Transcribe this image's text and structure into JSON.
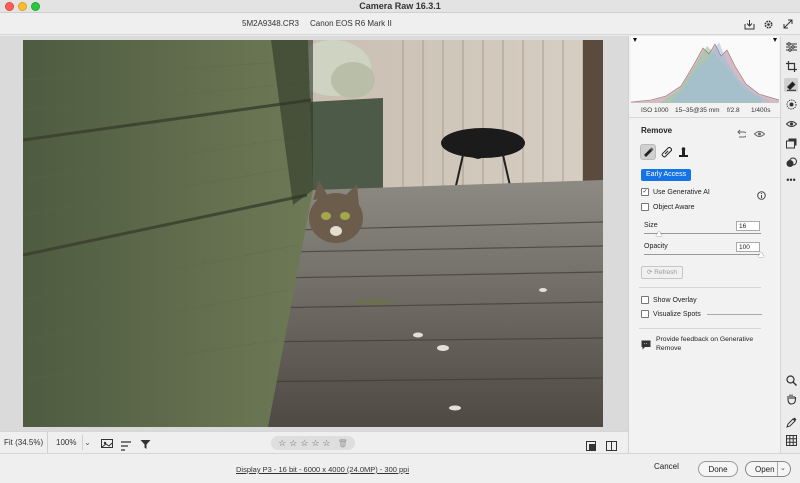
{
  "app_title": "Camera Raw 16.3.1",
  "header": {
    "filename": "5M2A9348.CR3",
    "camera": "Canon EOS R6 Mark II"
  },
  "metadata": {
    "iso": "ISO 1000",
    "lens": "15–35@35 mm",
    "aperture": "f/2.8",
    "shutter": "1/400s"
  },
  "remove_panel": {
    "title": "Remove",
    "badge": "Early Access",
    "use_generative_ai": {
      "label": "Use Generative AI",
      "checked": true
    },
    "object_aware": {
      "label": "Object Aware",
      "checked": false
    },
    "size": {
      "label": "Size",
      "value": "16",
      "fraction": 0.13
    },
    "opacity": {
      "label": "Opacity",
      "value": "100",
      "fraction": 1.0
    },
    "refresh_label": "Refresh",
    "show_overlay": {
      "label": "Show Overlay",
      "checked": false
    },
    "visualize_spots": {
      "label": "Visualize Spots",
      "checked": false
    },
    "feedback_text": "Provide feedback on Generative Remove"
  },
  "bottom_toolbar": {
    "zoom_fit": "Fit (34.5%)",
    "zoom_100": "100%"
  },
  "status": {
    "workflow": "Display P3 - 16 bit - 6000 x 4000 (24.0MP) - 300 ppi",
    "cancel": "Cancel",
    "done": "Done",
    "open": "Open"
  },
  "colors": {
    "accent": "#1473e6",
    "panel_bg": "#f2f2f2",
    "canvas_bg": "#dadada"
  }
}
